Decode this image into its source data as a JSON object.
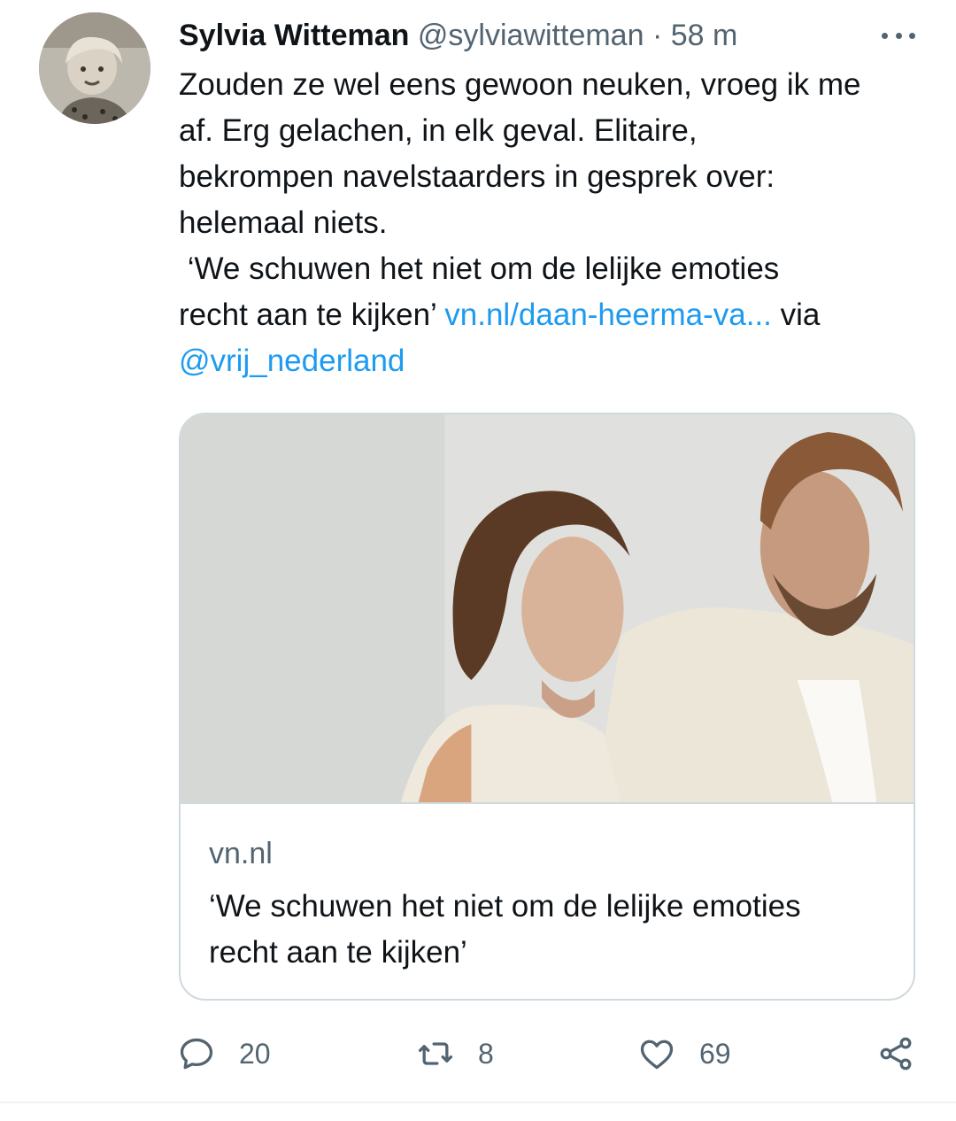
{
  "tweet": {
    "author_name": "Sylvia Witteman",
    "author_handle": "@sylviawitteman",
    "separator": "·",
    "time": "58 m",
    "text_lines": [
      "Zouden ze wel eens gewoon neuken, vroeg ik me",
      "af. Erg gelachen, in elk geval. Elitaire,",
      "bekrompen navelstaarders in gesprek over:",
      "helemaal niets.",
      " ‘We schuwen het niet om de lelijke emoties"
    ],
    "line6_text": "recht aan te kijken’ ",
    "line6_link": "vn.nl/daan-heerma-va...",
    "line6_after": " via",
    "mention": "@vrij_nederland"
  },
  "card": {
    "domain": "vn.nl",
    "title_line1": "‘We schuwen het niet om de lelijke emoties",
    "title_line2": "recht aan te kijken’"
  },
  "actions": {
    "reply_count": "20",
    "retweet_count": "8",
    "like_count": "69"
  },
  "colors": {
    "link": "#1d9bf0",
    "secondary_text": "#536471",
    "border": "#cfd9de"
  }
}
